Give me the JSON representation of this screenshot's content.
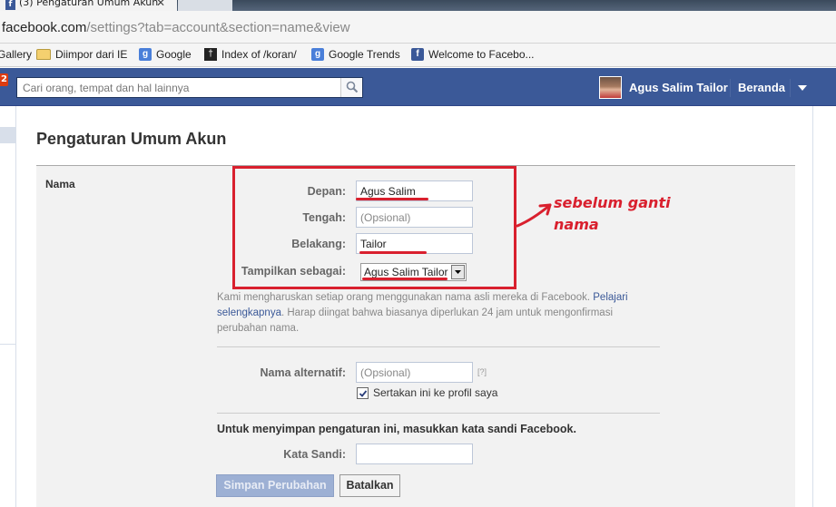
{
  "browser": {
    "tab_title": "(3) Pengaturan Umum Akun",
    "tab_close": "✕",
    "url_host": "facebook.com",
    "url_path": "/settings?tab=account&section=name&view",
    "bookmarks": [
      {
        "label": "Gallery",
        "icon": "none"
      },
      {
        "label": "Diimpor dari IE",
        "icon": "folder-icon"
      },
      {
        "label": "Google",
        "icon": "google-icon"
      },
      {
        "label": "Index of /koran/",
        "icon": "koran-icon"
      },
      {
        "label": "Google Trends",
        "icon": "google-icon"
      },
      {
        "label": "Welcome to Facebo...",
        "icon": "facebook-icon"
      }
    ]
  },
  "topbar": {
    "notification_count": "2",
    "search_placeholder": "Cari orang, tempat dan hal lainnya",
    "user_name": "Agus Salim Tailor",
    "home_label": "Beranda",
    "brand_color": "#3b5998"
  },
  "page": {
    "title": "Pengaturan Umum Akun",
    "section_label": "Nama",
    "fields": {
      "first_label": "Depan:",
      "first_value": "Agus Salim",
      "middle_label": "Tengah:",
      "middle_placeholder": "(Opsional)",
      "last_label": "Belakang:",
      "last_value": "Tailor",
      "display_label": "Tampilkan sebagai:",
      "display_value": "Agus Salim Tailor"
    },
    "help_text_1": "Kami mengharuskan setiap orang menggunakan nama asli mereka di Facebook. ",
    "help_link": "Pelajari selengkapnya",
    "help_text_2": ". Harap diingat bahwa biasanya diperlukan 24 jam untuk mengonfirmasi perubahan nama.",
    "alt_name_label": "Nama alternatif:",
    "alt_name_placeholder": "(Opsional)",
    "alt_help": "[?]",
    "include_profile_label": "Sertakan ini ke profil saya",
    "include_profile_checked": true,
    "save_note": "Untuk menyimpan pengaturan ini, masukkan kata sandi Facebook.",
    "password_label": "Kata Sandi:",
    "save_button": "Simpan Perubahan",
    "cancel_button": "Batalkan"
  },
  "annotation": {
    "text": "sebelum ganti nama",
    "color": "#d9202e"
  }
}
